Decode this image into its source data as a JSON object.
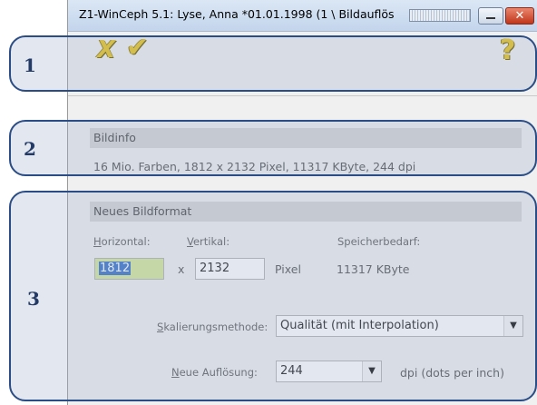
{
  "window": {
    "title": "Z1-WinCeph 5.1: Lyse, Anna *01.01.1998 (1 \\ Bildauflös"
  },
  "toolbar": {
    "cancel_icon": "cancel-x-icon",
    "ok_icon": "checkmark-icon",
    "help_icon": "help-question-icon",
    "cancel_glyph": "X",
    "ok_glyph": "✔",
    "help_glyph": "?"
  },
  "bildinfo": {
    "heading": "Bildinfo",
    "text": "16 Mio. Farben, 1812 x 2132 Pixel, 11317 KByte, 244 dpi"
  },
  "format": {
    "heading": "Neues Bildformat",
    "horizontal_label": "Horizontal:",
    "vertical_label": "Vertikal:",
    "memory_label": "Speicherbedarf:",
    "horizontal_value": "1812",
    "x_sep": "x",
    "vertical_value": "2132",
    "pixel_unit": "Pixel",
    "memory_value": "11317 KByte",
    "scaling_label": "Skalierungsmethode:",
    "scaling_value": "Qualität (mit Interpolation)",
    "resolution_label": "Neue Auflösung:",
    "resolution_value": "244",
    "resolution_unit": "dpi (dots per inch)"
  },
  "callouts": [
    "1",
    "2",
    "3"
  ],
  "colors": {
    "callout_border": "#2b4d86",
    "icon_yellow": "#e9c51e",
    "input_highlight": "#d7e89a",
    "selection": "#3b74c8"
  }
}
